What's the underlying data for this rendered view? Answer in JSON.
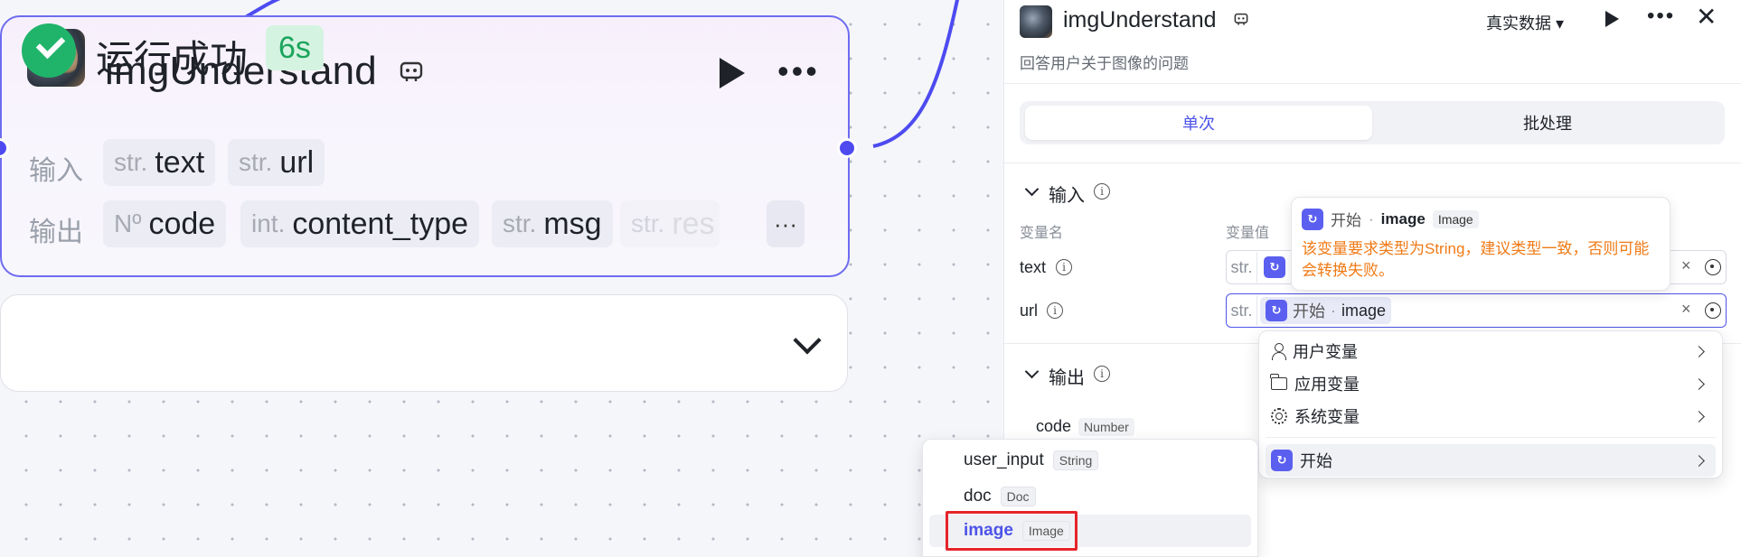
{
  "node": {
    "title": "imgUnderstand",
    "input_label": "输入",
    "output_label": "输出",
    "inputs": [
      {
        "type": "str.",
        "name": "text"
      },
      {
        "type": "str.",
        "name": "url"
      }
    ],
    "outputs": [
      {
        "type": "Nº",
        "name": "code"
      },
      {
        "type": "int.",
        "name": "content_type"
      },
      {
        "type": "str.",
        "name": "msg"
      },
      {
        "type": "str.",
        "name": "res"
      }
    ],
    "more_label": "···"
  },
  "run": {
    "status": "运行成功",
    "time": "6s"
  },
  "panel": {
    "title": "imgUnderstand",
    "description": "回答用户关于图像的问题",
    "mode_select": "真实数据",
    "tabs": [
      "单次",
      "批处理"
    ],
    "input_section": "输入",
    "output_section": "输出",
    "col_var_name": "变量名",
    "col_var_value": "变量值",
    "rows": [
      {
        "name": "text",
        "type": "str."
      },
      {
        "name": "url",
        "type": "str.",
        "ref_source": "开始",
        "ref_var": "image"
      }
    ],
    "outputs": [
      {
        "name": "code",
        "type": "Number"
      }
    ],
    "clear_icon": "×"
  },
  "tooltip": {
    "source": "开始",
    "var": "image",
    "type": "Image",
    "warning": "该变量要求类型为String，建议类型一致，否则可能会转换失败。"
  },
  "dropdown": {
    "items": [
      "用户变量",
      "应用变量",
      "系统变量",
      "开始"
    ],
    "selected": "开始"
  },
  "submenu": {
    "items": [
      {
        "name": "user_input",
        "type": "String"
      },
      {
        "name": "doc",
        "type": "Doc"
      },
      {
        "name": "image",
        "type": "Image"
      }
    ],
    "selected": "image"
  },
  "colors": {
    "accent": "#4d53e8",
    "success": "#1fb46a",
    "warning": "#f07a16",
    "highlight_box": "#e5242a"
  },
  "icons": [
    "robot-badge-icon",
    "play-icon",
    "more-icon",
    "check-circle-icon",
    "chevron-down-icon",
    "close-icon",
    "info-icon",
    "reference-icon",
    "user-icon",
    "folder-icon",
    "gear-icon",
    "chevron-right-icon"
  ]
}
